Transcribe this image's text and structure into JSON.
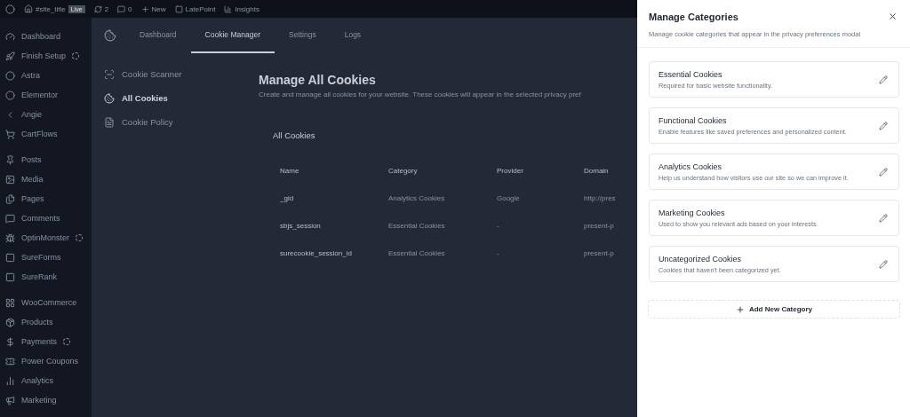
{
  "admin_bar": {
    "site_title": "#site_title",
    "status_badge": "Live",
    "updates": "2",
    "comments": "0",
    "new": "New",
    "items": [
      "LatePoint",
      "Insights"
    ]
  },
  "sidebar": {
    "groups": [
      [
        {
          "label": "Dashboard",
          "badge": false
        },
        {
          "label": "Finish Setup",
          "badge": true
        },
        {
          "label": "Astra",
          "badge": false
        },
        {
          "label": "Elementor",
          "badge": false
        },
        {
          "label": "Angie",
          "badge": false
        },
        {
          "label": "CartFlows",
          "badge": false
        }
      ],
      [
        {
          "label": "Posts",
          "badge": false
        },
        {
          "label": "Media",
          "badge": false
        },
        {
          "label": "Pages",
          "badge": false
        },
        {
          "label": "Comments",
          "badge": false
        },
        {
          "label": "OptinMonster",
          "badge": true
        },
        {
          "label": "SureForms",
          "badge": false
        },
        {
          "label": "SureRank",
          "badge": false
        }
      ],
      [
        {
          "label": "WooCommerce",
          "badge": false
        },
        {
          "label": "Products",
          "badge": false
        },
        {
          "label": "Payments",
          "badge": true
        },
        {
          "label": "Power Coupons",
          "badge": false
        },
        {
          "label": "Analytics",
          "badge": false
        },
        {
          "label": "Marketing",
          "badge": false
        }
      ]
    ]
  },
  "plugin_tabs": [
    {
      "label": "Dashboard",
      "selected": false
    },
    {
      "label": "Cookie Manager",
      "selected": true
    },
    {
      "label": "Settings",
      "selected": false
    },
    {
      "label": "Logs",
      "selected": false
    }
  ],
  "plugin_nav": [
    {
      "label": "Cookie Scanner",
      "selected": false
    },
    {
      "label": "All Cookies",
      "selected": true
    },
    {
      "label": "Cookie Policy",
      "selected": false
    }
  ],
  "content": {
    "title": "Manage All Cookies",
    "description": "Create and manage all cookies for your website. These cookies will appear in the selected privacy pref",
    "card_title": "All Cookies",
    "columns": [
      "Name",
      "Category",
      "Provider",
      "Domain"
    ],
    "rows": [
      [
        "_gid",
        "Analytics Cookies",
        "Google",
        "http://pres"
      ],
      [
        "sbjs_session",
        "Essential Cookies",
        "-",
        "present-p"
      ],
      [
        "surecookie_session_id",
        "Essential Cookies",
        "-",
        "present-p"
      ]
    ]
  },
  "panel": {
    "title": "Manage Categories",
    "subtitle": "Manage cookie categories that appear in the privacy preferences modal",
    "categories": [
      {
        "name": "Essential Cookies",
        "description": "Required for basic website functionality."
      },
      {
        "name": "Functional Cookies",
        "description": "Enable features like saved preferences and personalized content."
      },
      {
        "name": "Analytics Cookies",
        "description": "Help us understand how visitors use our site so we can improve it."
      },
      {
        "name": "Marketing Cookies",
        "description": "Used to show you relevant ads based on your interests."
      },
      {
        "name": "Uncategorized Cookies",
        "description": "Cookies that haven't been categorized yet."
      }
    ],
    "add_button": "Add New Category"
  }
}
